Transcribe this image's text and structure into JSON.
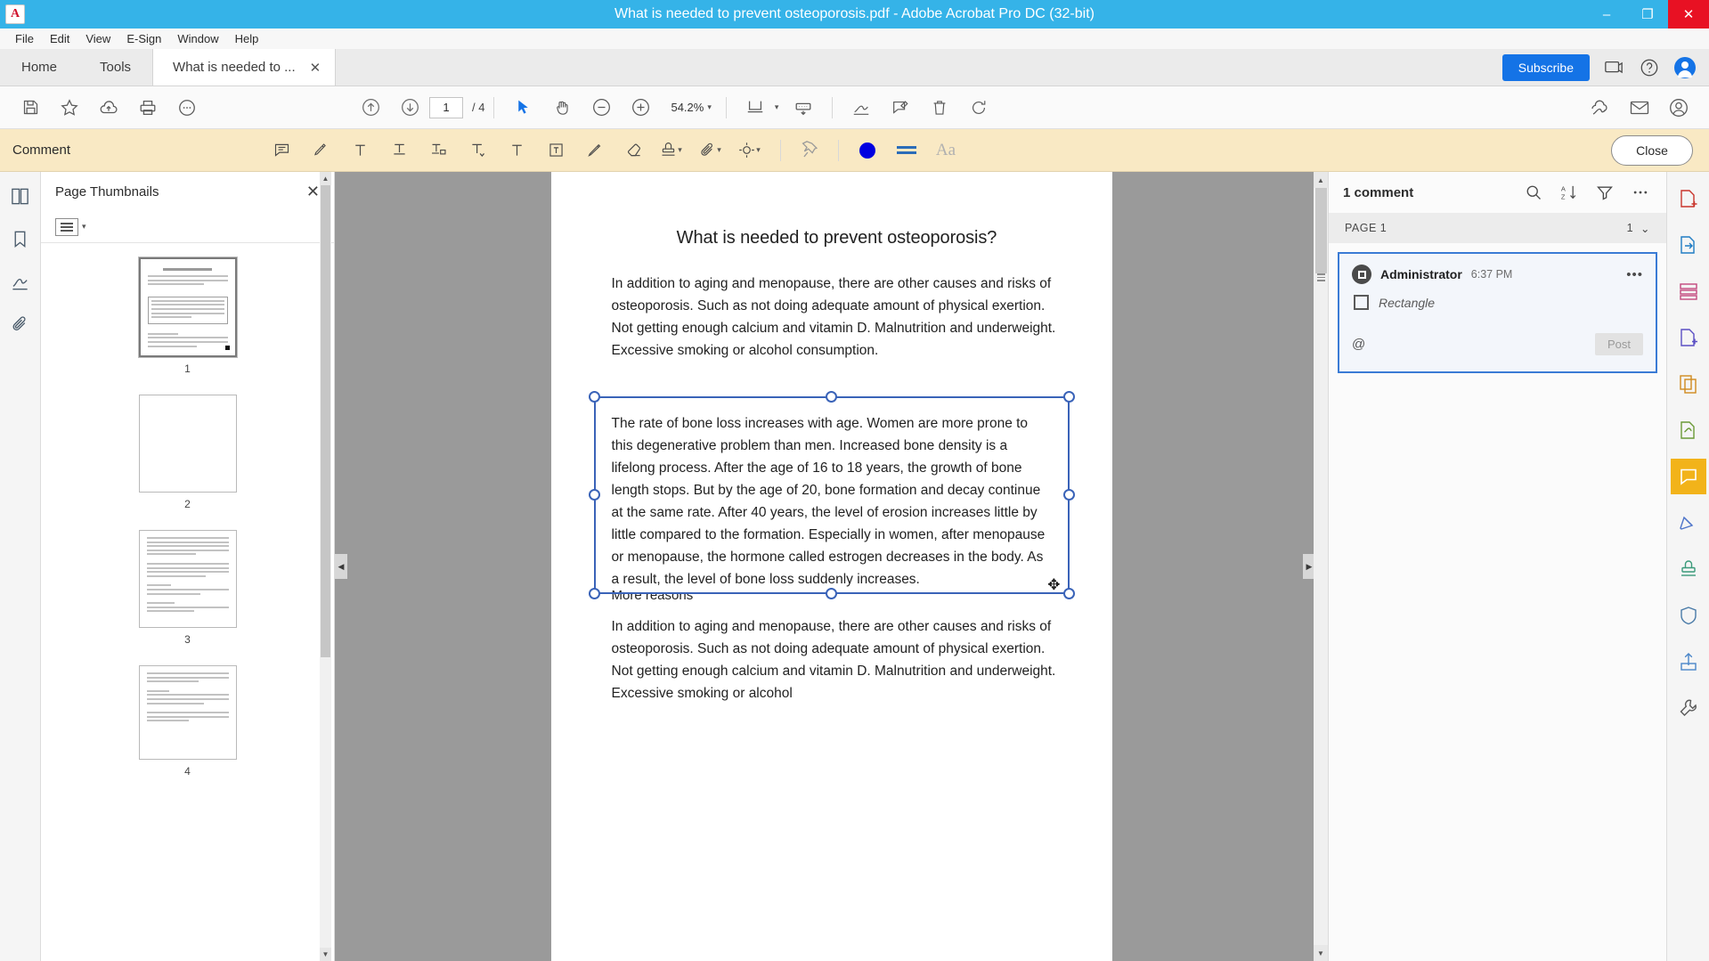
{
  "window": {
    "title": "What is needed to prevent osteoporosis.pdf - Adobe Acrobat Pro DC (32-bit)",
    "app_icon": "A",
    "minimize": "–",
    "maximize": "❐",
    "close": "✕"
  },
  "menubar": {
    "items": [
      {
        "label": "File"
      },
      {
        "label": "Edit"
      },
      {
        "label": "View"
      },
      {
        "label": "E-Sign"
      },
      {
        "label": "Window"
      },
      {
        "label": "Help"
      }
    ]
  },
  "tabbar": {
    "home": "Home",
    "tools": "Tools",
    "document_tab": "What is needed to ...",
    "document_tab_close": "✕",
    "subscribe": "Subscribe"
  },
  "toolbar": {
    "page_current": "1",
    "page_total": "/ 4",
    "zoom_level": "54.2%",
    "zoom_caret": "▾",
    "fit_caret": "▾",
    "page_display_caret": "▾"
  },
  "commentbar": {
    "label": "Comment",
    "close_label": "Close",
    "color": "#0000e0",
    "aa_label": "Aa"
  },
  "thumbnails": {
    "panel_title": "Page Thumbnails",
    "close": "✕",
    "options_caret": "▾",
    "pages": [
      {
        "number": "1",
        "selected": true
      },
      {
        "number": "2",
        "selected": false
      },
      {
        "number": "3",
        "selected": false
      },
      {
        "number": "4",
        "selected": false
      }
    ]
  },
  "document": {
    "heading": "What is needed to prevent osteoporosis?",
    "paragraph1": "In addition to aging and menopause, there are other causes and risks of osteoporosis. Such as not doing adequate amount of physical exertion. Not getting enough calcium and vitamin D. Malnutrition and underweight. Excessive smoking or alcohol consumption.",
    "selected_textbox": "The rate of bone loss increases with age. Women are more prone to this degenerative problem than men. Increased bone density is a lifelong process. After the age of 16 to 18 years, the growth of bone length stops. But by the age of 20, bone formation and decay continue at the same rate. After 40 years, the level of erosion increases little by little compared to the formation. Especially in women, after menopause or menopause, the hormone called estrogen decreases in the body. As a result, the level of bone loss suddenly increases.",
    "subheading": "More reasons",
    "paragraph2": "In addition to aging and menopause, there are other causes and risks of osteoporosis. Such as not doing adequate amount of physical exertion. Not getting enough calcium and vitamin D. Malnutrition and underweight. Excessive smoking or alcohol"
  },
  "comments_panel": {
    "title": "1 comment",
    "page_label": "PAGE 1",
    "page_count": "1",
    "page_count_caret": "⌄",
    "comment": {
      "author": "Administrator",
      "time": "6:37 PM",
      "more": "•••",
      "annotation_type": "Rectangle",
      "mention_symbol": "@",
      "post_label": "Post"
    }
  }
}
